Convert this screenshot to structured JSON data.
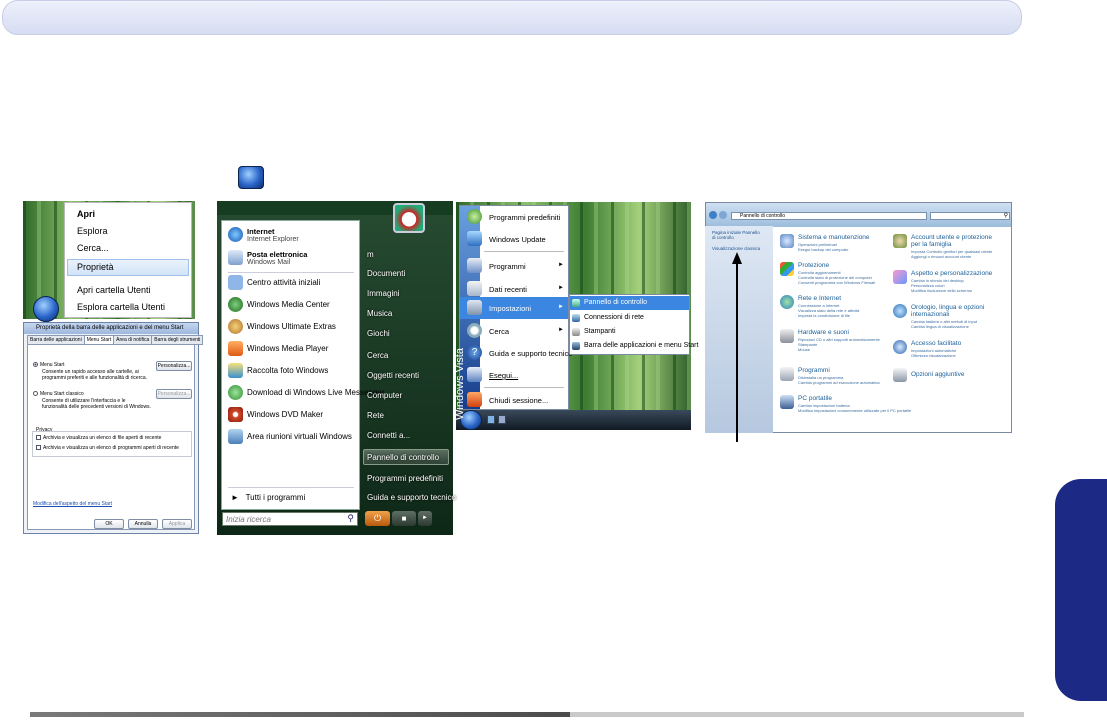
{
  "panel1": {
    "context_menu": [
      "Apri",
      "Esplora",
      "Cerca...",
      "Proprietà",
      "Apri cartella Utenti",
      "Esplora cartella Utenti"
    ],
    "selected": "Proprietà"
  },
  "panel2": {
    "title": "Proprietà della barra delle applicazioni e del menu Start",
    "tabs": [
      "Barra delle applicazioni",
      "Menu Start",
      "Area di notifica",
      "Barra degli strumenti"
    ],
    "opt1": "Menu Start",
    "opt1_desc": "Consente un rapido accesso alle cartelle, ai programmi preferiti e alle funzionalità di ricerca.",
    "opt2": "Menu Start classico",
    "opt2_desc": "Consente di utilizzare l'interfaccia e le funzionalità delle precedenti versioni di Windows.",
    "customize": "Personalizza...",
    "privacy": "Privacy",
    "check1": "Archivia e visualizza un elenco di file aperti di recente",
    "check2": "Archivia e visualizza un elenco di programmi aperti di recente",
    "link": "Modifica dell'aspetto del menu Start",
    "ok": "OK",
    "cancel": "Annulla",
    "apply": "Applica"
  },
  "panel3": {
    "pinned": [
      {
        "title": "Internet",
        "sub": "Internet Explorer"
      },
      {
        "title": "Posta elettronica",
        "sub": "Windows Mail"
      }
    ],
    "programs": [
      "Centro attività iniziali",
      "Windows Media Center",
      "Windows Ultimate Extras",
      "Windows Media Player",
      "Raccolta foto Windows",
      "Download di Windows Live Messenger",
      "Windows DVD Maker",
      "Area riunioni virtuali Windows"
    ],
    "all_programs": "Tutti i programmi",
    "search_placeholder": "Inizia ricerca",
    "user": "m",
    "right": [
      "Documenti",
      "Immagini",
      "Musica",
      "Giochi",
      "Cerca",
      "Oggetti recenti",
      "Computer",
      "Rete",
      "Connetti a...",
      "Pannello di controllo",
      "Programmi predefiniti",
      "Guida e supporto tecnico"
    ],
    "highlighted": "Pannello di controllo"
  },
  "panel4": {
    "banner": "Windows Vista",
    "items": [
      "Programmi predefiniti",
      "Windows Update",
      "Programmi",
      "Dati recenti",
      "Impostazioni",
      "Cerca",
      "Guida e supporto tecnico",
      "Esegui...",
      "Chiudi sessione..."
    ],
    "submenu": [
      "Pannello di controllo",
      "Connessioni di rete",
      "Stampanti",
      "Barra delle applicazioni e menu Start"
    ]
  },
  "panel5": {
    "address": "Pannello di controllo",
    "search_placeholder": "",
    "sidebar": [
      "Pagina iniziale Pannello di controllo",
      "Visualizzazione classica"
    ],
    "categories": [
      {
        "title": "Sistema e manutenzione",
        "links": [
          "Operazioni preliminari",
          "Esegui backup del computer"
        ]
      },
      {
        "title": "Protezione",
        "links": [
          "Controlla aggiornamenti",
          "Controlla stato di protezione del computer",
          "Consenti programma con Windows Firewall"
        ]
      },
      {
        "title": "Rete e Internet",
        "links": [
          "Connessione a Internet",
          "Visualizza stato della rete e attività",
          "Imposta la condivisione di file"
        ]
      },
      {
        "title": "Hardware e suoni",
        "links": [
          "Riproduci CD o altri supporti automaticamente",
          "Stampante",
          "Mouse"
        ]
      },
      {
        "title": "Programmi",
        "links": [
          "Disinstalla un programma",
          "Cambia programmi ad esecuzione automatica"
        ]
      },
      {
        "title": "PC portatile",
        "links": [
          "Cambia impostazioni batteria",
          "Modifica impostazioni comunemente utilizzate per il PC portatile"
        ]
      },
      {
        "title": "Account utente e protezione per la famiglia",
        "links": [
          "Imposta Controllo genitori per qualsiasi utente",
          "Aggiungi o rimuovi account utente"
        ]
      },
      {
        "title": "Aspetto e personalizzazione",
        "links": [
          "Cambia lo sfondo del desktop",
          "Personalizza colori",
          "Modifica risoluzione dello schermo"
        ]
      },
      {
        "title": "Orologio, lingua e opzioni internazionali",
        "links": [
          "Cambia tastiera o altri metodi di input",
          "Cambia lingua di visualizzazione"
        ]
      },
      {
        "title": "Accesso facilitato",
        "links": [
          "Impostazioni automatiche",
          "Ottimizza visualizzazione"
        ]
      },
      {
        "title": "Opzioni aggiuntive",
        "links": []
      }
    ]
  },
  "colors": {
    "side_tab": "#1c2a86",
    "highlight": "#3b86e0",
    "link": "#1a5f99"
  }
}
